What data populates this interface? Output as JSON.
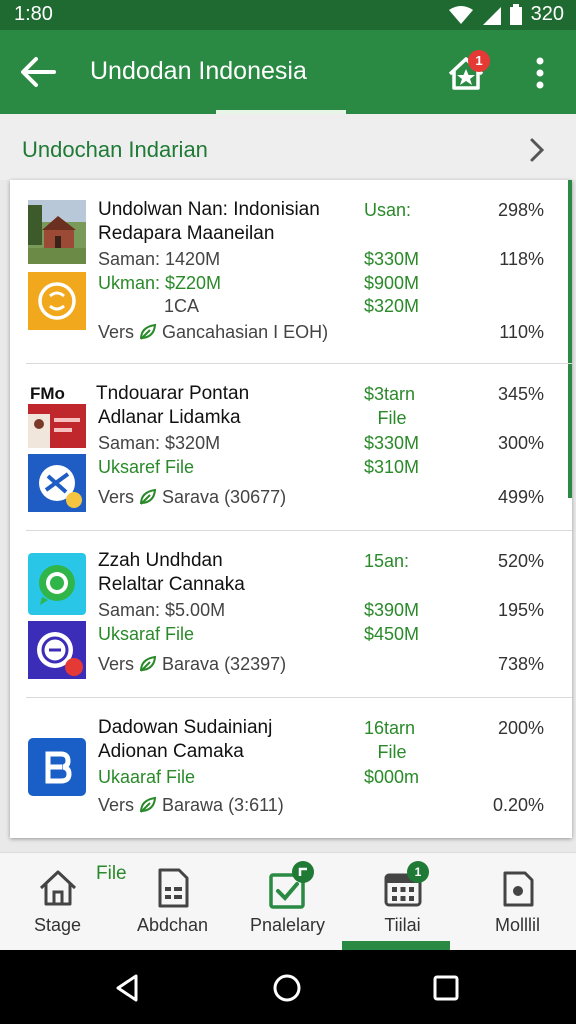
{
  "status_bar": {
    "time": "1:80",
    "battery": "320"
  },
  "app_bar": {
    "title": "Undodan Indonesia",
    "badge_count": "1",
    "back_icon": "arrow-left-icon",
    "notif_icon": "house-star-icon",
    "menu_icon": "more-vert-icon"
  },
  "section": {
    "title": "Undochan Indarian"
  },
  "items": [
    {
      "name1": "Undolwan Nan: Indonisian",
      "name2": "Redapara Maaneilan",
      "saman": "Saman: 1420M",
      "green1": "Ukman: $Z20M",
      "sub": "1CA",
      "version": "Gancahasian I EOH)",
      "mid": [
        "Usan:",
        "$330M",
        "$900M",
        "$320M"
      ],
      "pct": [
        "298%",
        "118%",
        "110%"
      ]
    },
    {
      "brand": "FMo",
      "name1": "Tndouarar Pontan",
      "name2": "Adlanar Lidamka",
      "saman": "Saman: $320M",
      "green1": "Uksaref File",
      "version": "Sarava (30677)",
      "mid": [
        "$3tarn",
        "File",
        "$330M",
        "$310M"
      ],
      "pct": [
        "345%",
        "300%",
        "499%"
      ]
    },
    {
      "name1": "Zzah Undhdan",
      "name2": "Relaltar Cannaka",
      "saman": "Saman: $5.00M",
      "green1": "Uksaraf File",
      "version": "Barava (32397)",
      "mid": [
        "15an:",
        "$390M",
        "$450M"
      ],
      "pct": [
        "520%",
        "195%",
        "738%"
      ]
    },
    {
      "name1": "Dadowan Sudainianj",
      "name2": "Adionan Camaka",
      "green1": "Ukaaraf File",
      "version": "Barawa (3:611)",
      "mid": [
        "16tarn",
        "File",
        "$000m"
      ],
      "pct": [
        "200%",
        "0.20%"
      ]
    }
  ],
  "vers_label": "Vers",
  "bottom_nav": {
    "file_tag": "File",
    "items": [
      {
        "label": "Stage",
        "icon": "home-icon"
      },
      {
        "label": "Abdchan",
        "icon": "document-icon"
      },
      {
        "label": "Pnalelary",
        "icon": "checklist-icon",
        "badge": ""
      },
      {
        "label": "Tiilai",
        "icon": "calendar-icon",
        "badge": "1"
      },
      {
        "label": "Molllil",
        "icon": "storage-icon"
      }
    ]
  },
  "colors": {
    "primary": "#2a8a43",
    "dark": "#1e6a31",
    "accent_text": "#2a8a2a",
    "badge": "#e53935"
  }
}
